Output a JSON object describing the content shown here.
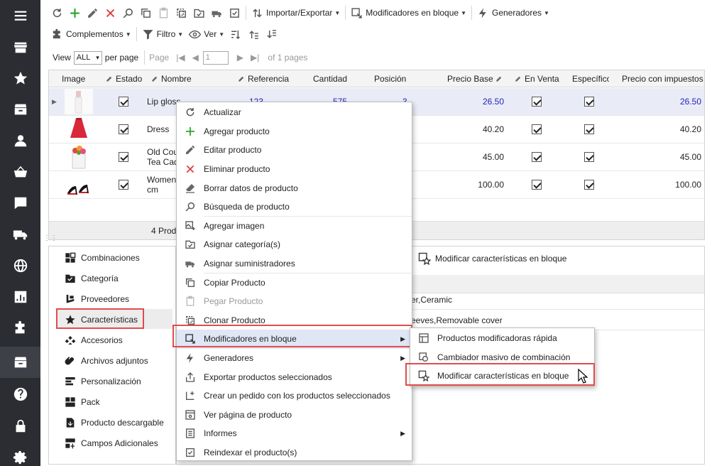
{
  "nav_icons": [
    "menu-icon",
    "store-icon",
    "star-icon",
    "box-icon",
    "user-icon",
    "basket-icon",
    "comment-icon",
    "truck-icon",
    "globe-icon",
    "chart-icon",
    "puzzle-icon",
    "archive-icon",
    "help-icon",
    "lock-icon",
    "gear-icon"
  ],
  "toolbar": {
    "import_export": "Importar/Exportar",
    "bulk_modifiers": "Modificadores en bloque",
    "generators": "Generadores",
    "addons": "Complementos",
    "filter": "Filtro",
    "view": "Ver"
  },
  "pager": {
    "view_label": "View",
    "view_value": "ALL",
    "per_page": "per page",
    "page_label": "Page",
    "page_value": "1",
    "of_pages": "of 1 pages"
  },
  "grid": {
    "columns": [
      "Image",
      "Estado",
      "Nombre",
      "Referencia",
      "Cantidad",
      "Posición",
      "Precio Base",
      "En Venta",
      "Específico",
      "Precio con impuestos"
    ],
    "rows": [
      {
        "name": "Lip gloss",
        "name2": "",
        "ref": "123",
        "qty": "575",
        "pos": "3",
        "price": "26.50",
        "price_tax": "26.50"
      },
      {
        "name": "Dress",
        "name2": "",
        "ref": "",
        "qty": "",
        "pos": "",
        "price": "40.20",
        "price_tax": "40.20"
      },
      {
        "name": "Old Cou",
        "name2": "Tea Cad",
        "ref": "",
        "qty": "",
        "pos": "",
        "price": "45.00",
        "price_tax": "45.00"
      },
      {
        "name": "Women",
        "name2": "cm",
        "ref": "",
        "qty": "",
        "pos": "",
        "price": "100.00",
        "price_tax": "100.00"
      }
    ],
    "footer": "4 Produ"
  },
  "left_panel": {
    "items": [
      "Combinaciones",
      "Categoría",
      "Proveedores",
      "Características",
      "Accesorios",
      "Archivos adjuntos",
      "Personalización",
      "Pack",
      "Producto descargable",
      "Campos Adicionales"
    ]
  },
  "right_panel": {
    "toolbar_button": "Modificar características en bloque",
    "rows": [
      "er,Ceramic",
      "eeves,Removable cover"
    ]
  },
  "context_menu": {
    "items": [
      {
        "label": "Actualizar",
        "icon": "refresh-icon"
      },
      {
        "label": "Agregar producto",
        "icon": "plus-icon"
      },
      {
        "label": "Editar producto",
        "icon": "pencil-icon"
      },
      {
        "label": "Eliminar producto",
        "icon": "x-icon"
      },
      {
        "label": "Borrar datos de producto",
        "icon": "eraser-icon"
      },
      {
        "label": "Búsqueda de producto",
        "icon": "search-icon"
      },
      {
        "label": "Agregar imagen",
        "icon": "add-image-icon"
      },
      {
        "label": "Asignar categoría(s)",
        "icon": "category-icon"
      },
      {
        "label": "Asignar suministradores",
        "icon": "supplier-icon"
      },
      {
        "label": "Copiar Producto",
        "icon": "copy-icon"
      },
      {
        "label": "Pegar Producto",
        "icon": "paste-icon"
      },
      {
        "label": "Clonar Producto",
        "icon": "clone-icon"
      },
      {
        "label": "Modificadores en bloque",
        "icon": "bulk-icon"
      },
      {
        "label": "Generadores",
        "icon": "lightning-icon"
      },
      {
        "label": "Exportar productos seleccionados",
        "icon": "export-icon"
      },
      {
        "label": "Crear un pedido con los productos seleccionados",
        "icon": "order-icon"
      },
      {
        "label": "Ver página de producto",
        "icon": "eye-page-icon"
      },
      {
        "label": "Informes",
        "icon": "report-icon"
      },
      {
        "label": "Reindexar el producto(s)",
        "icon": "reindex-icon"
      }
    ]
  },
  "submenu": {
    "items": [
      {
        "label": "Productos modificadoras rápida",
        "icon": "quick-edit-icon"
      },
      {
        "label": "Cambiador masivo de combinación",
        "icon": "combination-icon"
      },
      {
        "label": "Modificar características en bloque",
        "icon": "star-box-icon"
      }
    ]
  },
  "colors": {
    "sidebar": "#2b2d33",
    "highlight_red": "#e24c4c",
    "price_blue": "#2323b8",
    "add_green": "#2aa52a",
    "delete_red": "#e03b3b"
  }
}
